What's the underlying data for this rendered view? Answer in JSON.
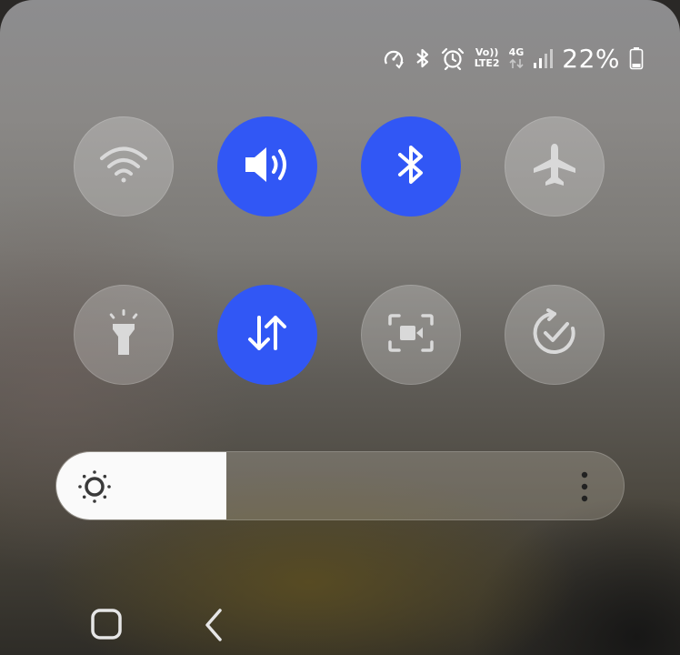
{
  "status_bar": {
    "icons": [
      "data-saver-icon",
      "bluetooth-icon",
      "alarm-icon",
      "volte-icon",
      "4g-icon",
      "signal-icon",
      "battery-icon"
    ],
    "volte_top": "Vo))",
    "volte_bottom": "LTE2",
    "network_type": "4G",
    "battery_percent": "22%"
  },
  "quick_settings": {
    "row1": [
      {
        "name": "Wi-Fi",
        "icon": "wifi-icon",
        "on": false
      },
      {
        "name": "Sound",
        "icon": "sound-icon",
        "on": true
      },
      {
        "name": "Bluetooth",
        "icon": "bluetooth-icon",
        "on": true
      },
      {
        "name": "Airplane mode",
        "icon": "airplane-icon",
        "on": false
      }
    ],
    "row2": [
      {
        "name": "Flashlight",
        "icon": "flashlight-icon",
        "on": false
      },
      {
        "name": "Mobile data",
        "icon": "mobile-data-icon",
        "on": true
      },
      {
        "name": "Screen recorder",
        "icon": "screen-recorder-icon",
        "on": false
      },
      {
        "name": "Auto rotate",
        "icon": "auto-rotate-icon",
        "on": false
      }
    ]
  },
  "brightness": {
    "level": 0.3,
    "icon": "sun-icon",
    "more_icon": "more-vertical-icon"
  },
  "navigation": {
    "icons": [
      "home-icon",
      "back-icon"
    ]
  },
  "colors": {
    "accent": "#3157f5",
    "tile_off": "rgba(255,255,255,0.22)",
    "icon_off": "#d9d9d9",
    "icon_on": "#ffffff"
  }
}
